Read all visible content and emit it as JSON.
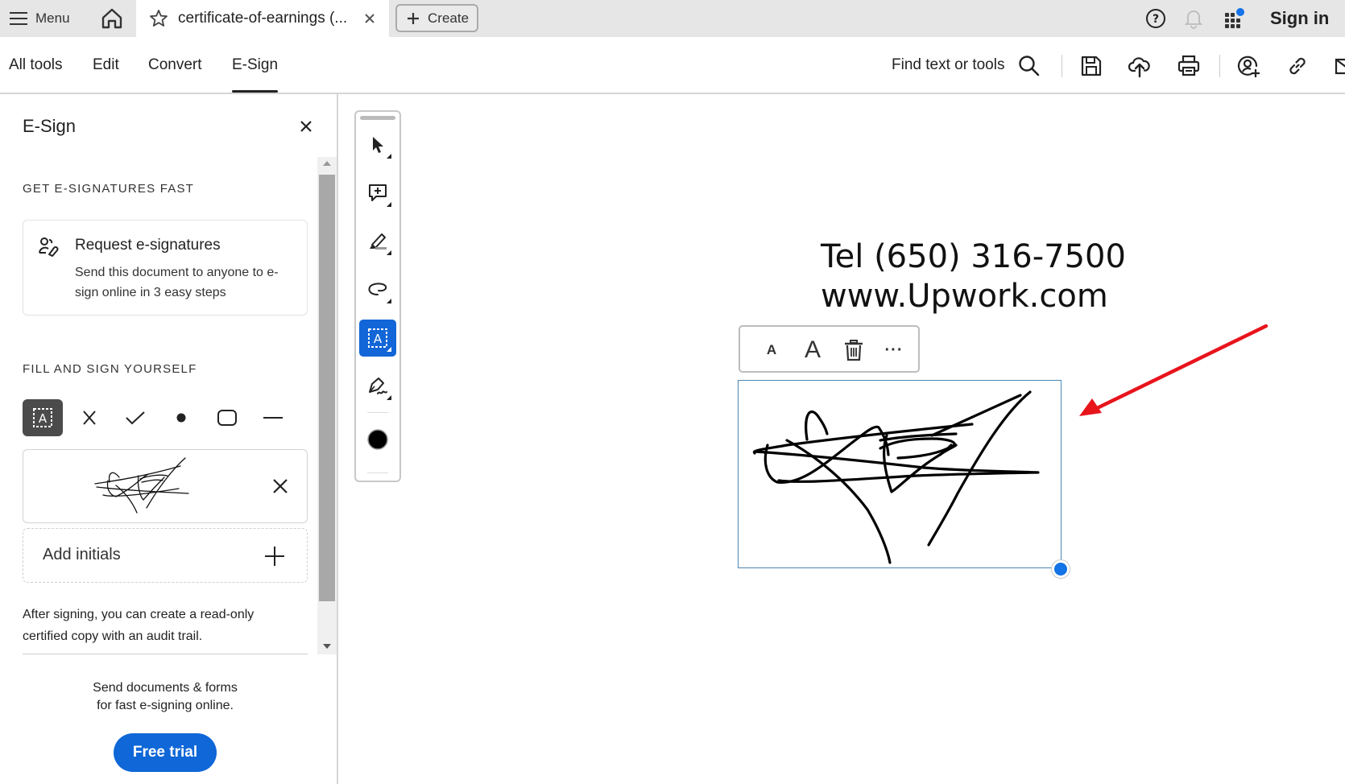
{
  "topbar": {
    "menu_label": "Menu",
    "home_icon": "home-icon",
    "tab_title": "certificate-of-earnings (...",
    "create_label": "Create",
    "help_icon": "help-icon",
    "notifications_icon": "bell-icon",
    "apps_icon": "apps-grid-icon",
    "apps_badge_color": "#1473e6",
    "signin_label": "Sign in"
  },
  "nav": {
    "tabs": [
      {
        "label": "All tools",
        "active": false
      },
      {
        "label": "Edit",
        "active": false
      },
      {
        "label": "Convert",
        "active": false
      },
      {
        "label": "E-Sign",
        "active": true
      }
    ],
    "find_label": "Find text or tools",
    "actions": [
      "search-icon",
      "save-icon",
      "upload-cloud-icon",
      "print-icon",
      "share-user-icon",
      "link-icon",
      "email-icon"
    ]
  },
  "sidebar": {
    "title": "E-Sign",
    "section1": "GET E-SIGNATURES FAST",
    "request": {
      "title": "Request e-signatures",
      "description": "Send this document to anyone to e-sign online in 3 easy steps"
    },
    "section2": "FILL AND SIGN YOURSELF",
    "fill_tools": [
      "text-field-icon",
      "cross-mark-icon",
      "checkmark-icon",
      "dot-icon",
      "rounded-box-icon",
      "line-icon"
    ],
    "initials_label": "Add initials",
    "after_text": "After signing, you can create a read-only certified copy with an audit trail.",
    "promo_line1": "Send documents & forms",
    "promo_line2": "for fast e-signing online.",
    "free_trial_label": "Free trial",
    "accent_color": "#0f67d8"
  },
  "tool_strip": {
    "tools": [
      "select-arrow-icon",
      "add-comment-icon",
      "highlighter-icon",
      "lasso-draw-icon",
      "text-field-icon",
      "sign-pen-icon"
    ],
    "active_tool": "text-field-icon",
    "color_swatch": "#000000"
  },
  "document": {
    "line1": "Tel (650) 316-7500",
    "line2": "www.Upwork.com"
  },
  "signature_toolbar": {
    "buttons": [
      "decrease-size-icon",
      "increase-size-icon",
      "delete-icon",
      "more-options-icon"
    ],
    "small_a": "A",
    "large_a": "A",
    "more": "···"
  },
  "annotation": {
    "arrow_color": "#e8141c"
  }
}
